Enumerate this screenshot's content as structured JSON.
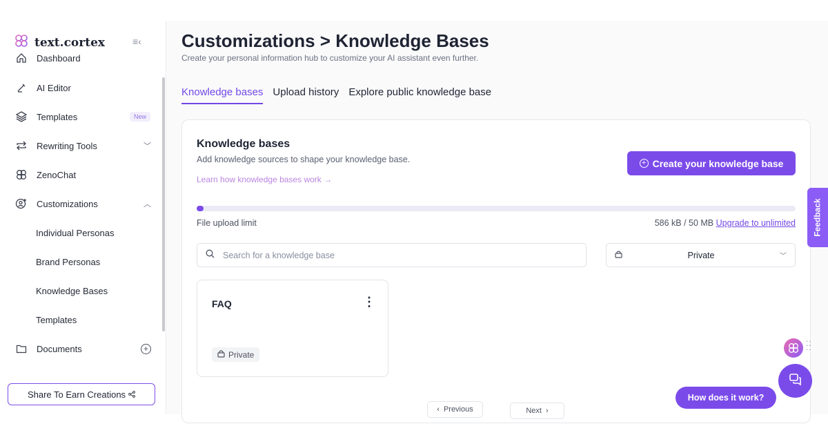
{
  "brand": {
    "name": "text.cortex",
    "logo_icon": "brain-logo-icon",
    "collapse_icon": "collapse-sidebar-icon"
  },
  "sidebar": {
    "items": [
      {
        "label": "Dashboard",
        "icon": "home-icon"
      },
      {
        "label": "AI Editor",
        "icon": "pen-icon"
      },
      {
        "label": "Templates",
        "icon": "layers-icon",
        "badge": "New"
      },
      {
        "label": "Rewriting Tools",
        "icon": "repeat-icon",
        "chevron": "down"
      },
      {
        "label": "ZenoChat",
        "icon": "brain-icon"
      },
      {
        "label": "Customizations",
        "icon": "user-add-icon",
        "chevron": "up"
      },
      {
        "label": "Individual Personas"
      },
      {
        "label": "Brand Personas"
      },
      {
        "label": "Knowledge Bases"
      },
      {
        "label": "Templates"
      },
      {
        "label": "Documents",
        "icon": "folder-icon",
        "action_icon": "plus-circle-icon"
      }
    ],
    "share_button": "Share To Earn Creations"
  },
  "header": {
    "title": "Customizations > Knowledge Bases",
    "subtitle": "Create your personal information hub to customize your AI assistant even further."
  },
  "tabs": [
    {
      "label": "Knowledge bases",
      "active": true
    },
    {
      "label": "Upload history",
      "active": false
    },
    {
      "label": "Explore public knowledge base",
      "active": false
    }
  ],
  "knowledge_section": {
    "title": "Knowledge bases",
    "description": "Add knowledge sources to shape your knowledge base.",
    "learn_link": "Learn how knowledge bases work →",
    "create_button": "Create your knowledge base",
    "upload_limit_label": "File upload limit",
    "usage": "586 kB / 50 MB",
    "upgrade_link": "Upgrade to unlimited",
    "usage_fraction": 0.0117,
    "search_placeholder": "Search for a knowledge base",
    "filter_value": "Private"
  },
  "knowledge_bases": [
    {
      "title": "FAQ",
      "visibility": "Private"
    }
  ],
  "pagination": {
    "previous": "Previous",
    "next": "Next"
  },
  "floating": {
    "feedback": "Feedback",
    "how_button": "How does it work?"
  },
  "colors": {
    "accent": "#7b4bea",
    "link": "#7248e6"
  }
}
